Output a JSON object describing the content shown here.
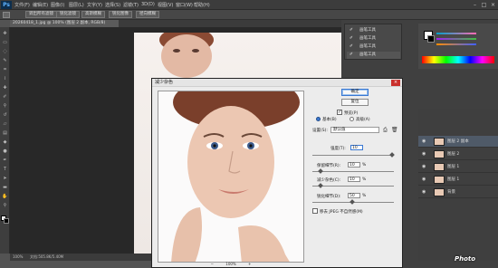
{
  "app": {
    "logo": "Ps",
    "menus": [
      "文件(F)",
      "编辑(E)",
      "图像(I)",
      "图层(L)",
      "文字(Y)",
      "选择(S)",
      "滤镜(T)",
      "3D(D)",
      "视图(V)",
      "窗口(W)",
      "帮助(H)"
    ],
    "window_buttons": [
      "–",
      "□",
      "×"
    ]
  },
  "options_bar": {
    "buttons": [
      "调出所有滤镜",
      "锐化滤镜",
      "高斯模糊",
      "锐化图像",
      "径向模糊"
    ]
  },
  "document": {
    "tab_title": "20260418_1.jpg @ 100% (图层 2 副本, RGB/8)",
    "status_zoom": "100%",
    "status_doc": "文档:505.8K/5.40M"
  },
  "history": {
    "items": [
      "画笔工具",
      "画笔工具",
      "画笔工具",
      "画笔工具"
    ]
  },
  "layers": {
    "items": [
      {
        "name": "图层 2 副本",
        "selected": true
      },
      {
        "name": "图层 2",
        "selected": false
      },
      {
        "name": "图层 1",
        "selected": false
      },
      {
        "name": "图层 1",
        "selected": false
      },
      {
        "name": "背景",
        "selected": false
      }
    ]
  },
  "dialog": {
    "title": "减少杂色",
    "ok": "确定",
    "reset": "复位",
    "preview_label": "预览(P)",
    "mode_basic": "基本(B)",
    "mode_advanced": "高级(A)",
    "settings_label": "设置(S):",
    "settings_value": "默认值",
    "strength_label": "强度(T):",
    "strength_value": "10",
    "preserve_label": "保留细节(R):",
    "preserve_value": "10",
    "reduce_color_label": "减少杂色(C):",
    "reduce_color_value": "10",
    "sharpen_label": "锐化细节(D):",
    "sharpen_value": "50",
    "percent": "%",
    "jpeg_label": "移去 JPEG 不自然感(M)",
    "preview_zoom": "100%",
    "zoom_out": "−",
    "zoom_in": "+"
  },
  "sliders": {
    "strength": 1.0,
    "preserve": 0.1,
    "reduce_color": 0.1,
    "sharpen": 0.5
  },
  "watermark": "Photo",
  "colors": {
    "accent": "#3a78d2",
    "panel": "#404040",
    "dialog_bg": "#ececec"
  }
}
